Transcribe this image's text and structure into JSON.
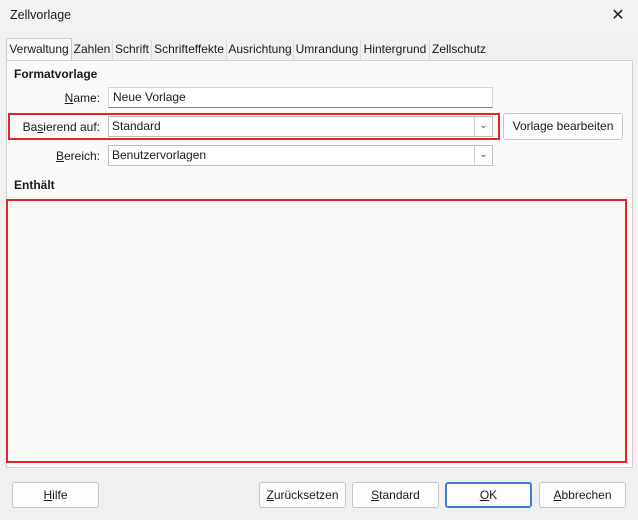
{
  "window": {
    "title": "Zellvorlage",
    "close_symbol": "✕"
  },
  "tabs": [
    {
      "label": "Verwaltung",
      "active": true
    },
    {
      "label": "Zahlen"
    },
    {
      "label": "Schrift"
    },
    {
      "label": "Schrifteffekte"
    },
    {
      "label": "Ausrichtung"
    },
    {
      "label": "Umrandung"
    },
    {
      "label": "Hintergrund"
    },
    {
      "label": "Zellschutz"
    }
  ],
  "formatvorlage": {
    "section_title": "Formatvorlage",
    "name": {
      "label_u": "N",
      "label_rest": "ame:",
      "value": "Neue Vorlage"
    },
    "basierend": {
      "label_pre": "Ba",
      "label_u": "s",
      "label_rest": "ierend auf:",
      "value": "Standard"
    },
    "bereich": {
      "label_u": "B",
      "label_rest": "ereich:",
      "value": "Benutzervorlagen"
    },
    "edit_button": "Vorlage bearbeiten"
  },
  "enthaelt": {
    "section_title": "Enthält"
  },
  "buttons": {
    "help": {
      "label_u": "H",
      "label_rest": "ilfe"
    },
    "reset": {
      "label_u": "Z",
      "label_rest": "urücksetzen"
    },
    "standard": {
      "label_u": "S",
      "label_rest": "tandard"
    },
    "ok": {
      "label_u": "O",
      "label_rest": "K"
    },
    "cancel": {
      "label_u": "A",
      "label_rest": "bbrechen"
    }
  },
  "colors": {
    "highlight": "#e3242b",
    "focus_blue": "#3c7bd6"
  }
}
